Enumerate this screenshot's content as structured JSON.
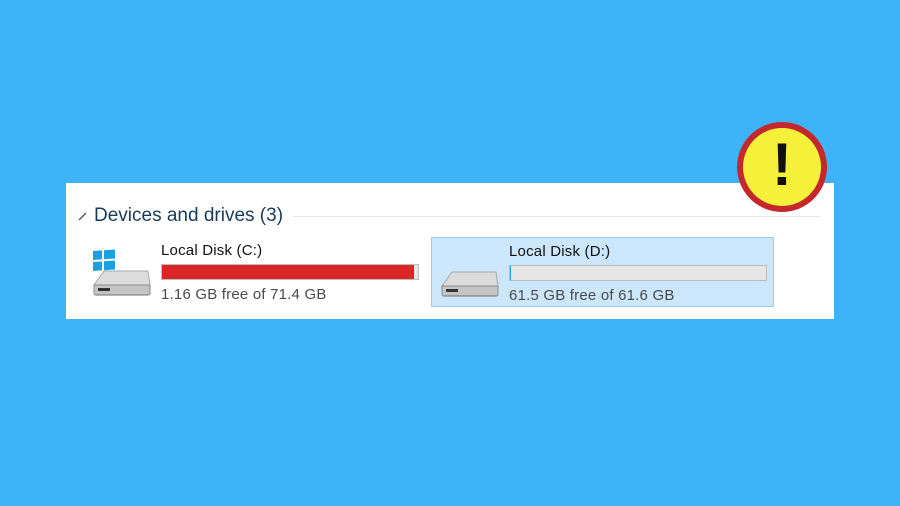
{
  "section": {
    "title": "Devices and drives (3)",
    "icon": "chevron-collapse-icon"
  },
  "drives": [
    {
      "name": "Local Disk (C:)",
      "free_text": "1.16 GB free of 71.4 GB",
      "used_fraction": 0.984,
      "bar_color": "#da2626",
      "icon": "windows-drive-icon",
      "selected": false
    },
    {
      "name": "Local Disk (D:)",
      "free_text": "61.5 GB free of 61.6 GB",
      "used_fraction": 0.002,
      "bar_color": "#26a0da",
      "icon": "hard-drive-icon",
      "selected": true
    }
  ],
  "warning_badge": {
    "symbol": "!",
    "icon": "warning-exclamation-icon",
    "fill_color": "#f5f03a",
    "ring_color": "#c4272c"
  },
  "colors": {
    "background": "#3fb3f8",
    "panel": "#ffffff",
    "selection": "#cce6fb"
  }
}
